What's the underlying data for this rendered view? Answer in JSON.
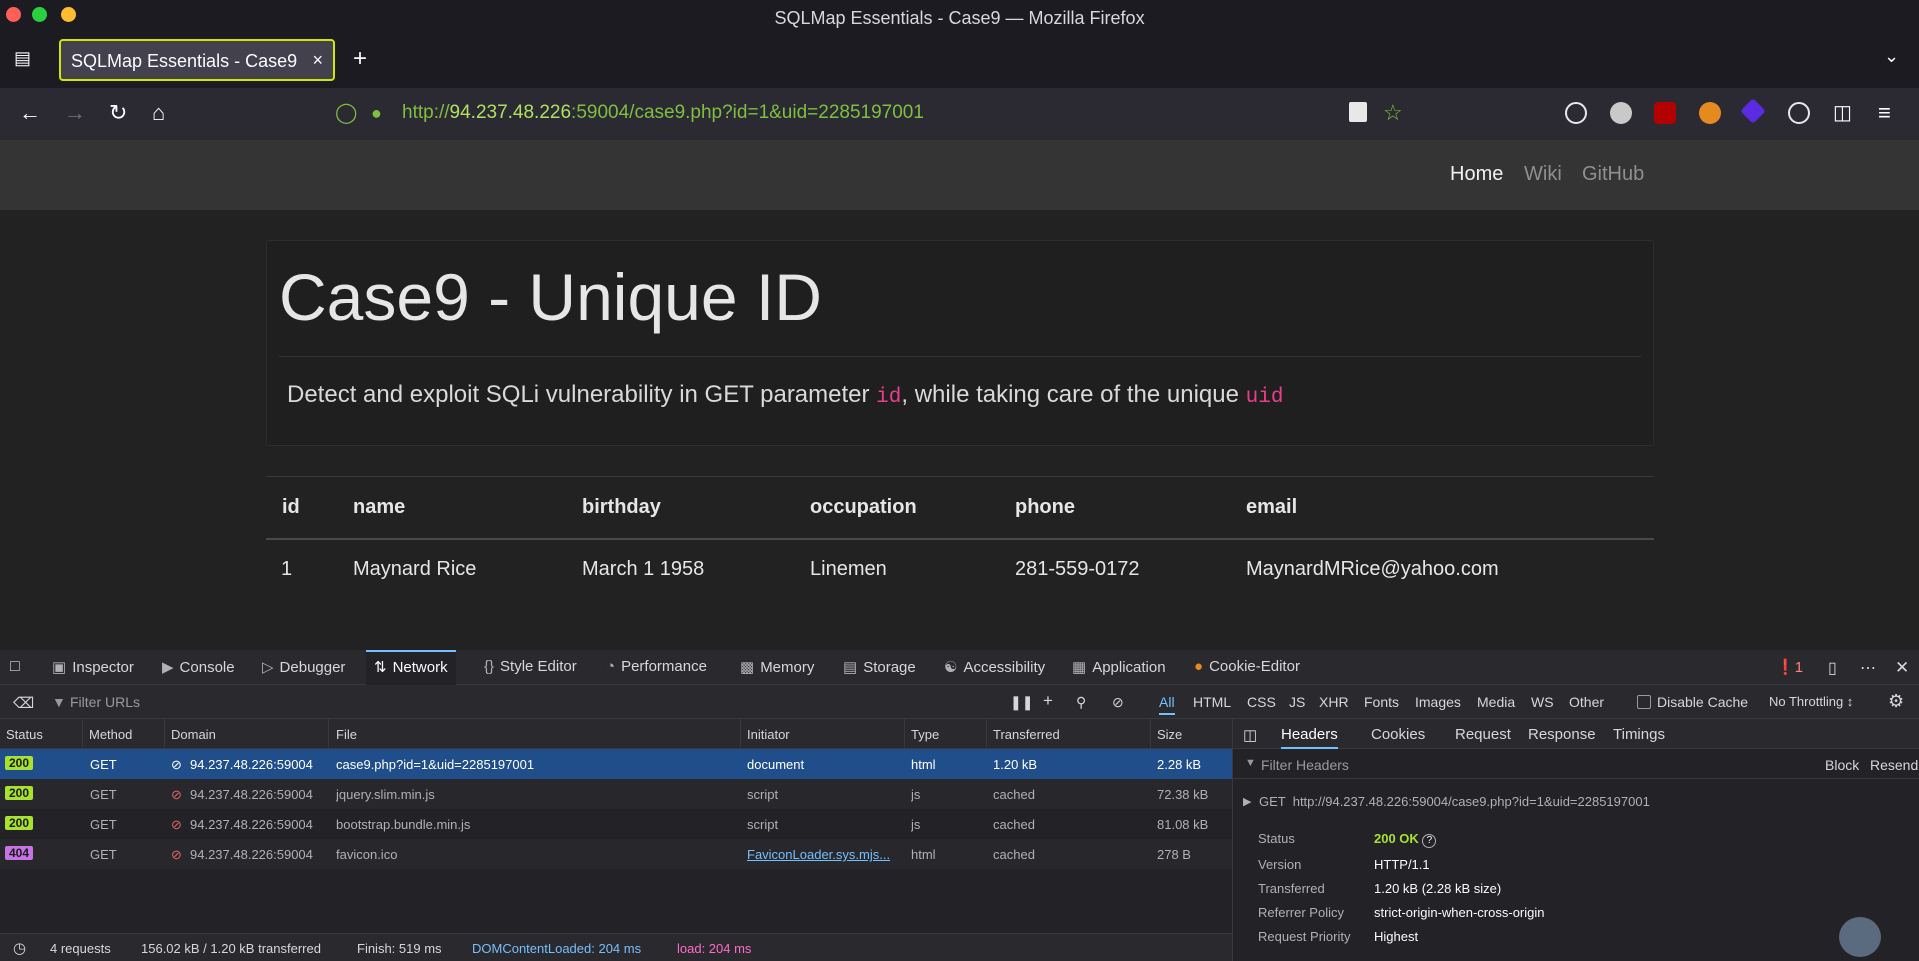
{
  "window": {
    "title": "SQLMap Essentials - Case9 — Mozilla Firefox"
  },
  "tab": {
    "title": "SQLMap Essentials - Case9",
    "close": "×",
    "new_tab": "+"
  },
  "urlbar": {
    "scheme": "http://",
    "host": "94.237.48.226",
    "rest": ":59004/case9.php?id=1&uid=2285197001"
  },
  "site": {
    "nav": [
      "Home",
      "Wiki",
      "GitHub"
    ],
    "heading": "Case9 - Unique ID",
    "lead_1": "Detect and exploit SQLi vulnerability in GET parameter ",
    "lead_code_1": "id",
    "lead_2": ", while taking care of the unique ",
    "lead_code_2": "uid",
    "table": {
      "headers": [
        "id",
        "name",
        "birthday",
        "occupation",
        "phone",
        "email"
      ],
      "row": [
        "1",
        "Maynard Rice",
        "March 1 1958",
        "Linemen",
        "281-559-0172",
        "MaynardMRice@yahoo.com"
      ]
    }
  },
  "devtools": {
    "tabs": [
      "Inspector",
      "Console",
      "Debugger",
      "Network",
      "Style Editor",
      "Performance",
      "Memory",
      "Storage",
      "Accessibility",
      "Application",
      "Cookie-Editor"
    ],
    "error_count": "1",
    "filter_placeholder": "Filter URLs",
    "type_filters": [
      "All",
      "HTML",
      "CSS",
      "JS",
      "XHR",
      "Fonts",
      "Images",
      "Media",
      "WS",
      "Other"
    ],
    "disable_cache": "Disable Cache",
    "throttling": "No Throttling ↕",
    "columns": [
      "Status",
      "Method",
      "Domain",
      "File",
      "Initiator",
      "Type",
      "Transferred",
      "Size"
    ],
    "requests": [
      {
        "status": "200",
        "method": "GET",
        "domain": "94.237.48.226:59004",
        "file": "case9.php?id=1&uid=2285197001",
        "initiator": "document",
        "type": "html",
        "transferred": "1.20 kB",
        "size": "2.28 kB"
      },
      {
        "status": "200",
        "method": "GET",
        "domain": "94.237.48.226:59004",
        "file": "jquery.slim.min.js",
        "initiator": "script",
        "type": "js",
        "transferred": "cached",
        "size": "72.38 kB"
      },
      {
        "status": "200",
        "method": "GET",
        "domain": "94.237.48.226:59004",
        "file": "bootstrap.bundle.min.js",
        "initiator": "script",
        "type": "js",
        "transferred": "cached",
        "size": "81.08 kB"
      },
      {
        "status": "404",
        "method": "GET",
        "domain": "94.237.48.226:59004",
        "file": "favicon.ico",
        "initiator": "FaviconLoader.sys.mjs...",
        "type": "html",
        "transferred": "cached",
        "size": "278 B"
      }
    ],
    "summary": {
      "requests": "4 requests",
      "transferred": "156.02 kB / 1.20 kB transferred",
      "finish": "Finish: 519 ms",
      "dcl": "DOMContentLoaded: 204 ms",
      "load": "load: 204 ms"
    },
    "side_tabs": [
      "Headers",
      "Cookies",
      "Request",
      "Response",
      "Timings"
    ],
    "filter_headers": "Filter Headers",
    "block": "Block",
    "resend": "Resend",
    "get_line": "GET  http://94.237.48.226:59004/case9.php?id=1&uid=2285197001",
    "headers": [
      {
        "label": "Status",
        "value": "200 OK"
      },
      {
        "label": "Version",
        "value": "HTTP/1.1"
      },
      {
        "label": "Transferred",
        "value": "1.20 kB (2.28 kB size)"
      },
      {
        "label": "Referrer Policy",
        "value": "strict-origin-when-cross-origin"
      },
      {
        "label": "Request Priority",
        "value": "Highest"
      }
    ]
  },
  "colors": {
    "status_ok": "#a6e22e",
    "status_404": "#c673e6",
    "accent": "#75bfff",
    "tab_border": "#d0e800"
  }
}
